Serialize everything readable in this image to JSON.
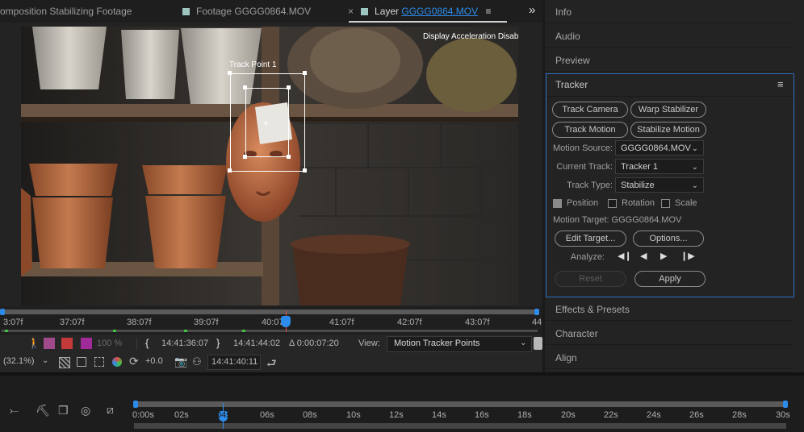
{
  "tabs": {
    "composition": "omposition Stabilizing Footage",
    "footage_prefix": "Footage",
    "footage_name": "GGGG0864.MOV",
    "layer_prefix": "Layer",
    "layer_name": "GGGG0864.MOV",
    "close_glyph": "×",
    "menu_glyph": "≡",
    "overflow_glyph": "»"
  },
  "viewer": {
    "notice": "Display Acceleration Disabled",
    "track_point_label": "Track Point 1"
  },
  "ruler": {
    "ticks": [
      "3:07f",
      "37:07f",
      "38:07f",
      "39:07f",
      "40:07",
      "41:07f",
      "42:07f",
      "43:07f",
      "44"
    ]
  },
  "controls": {
    "in_time": "14:41:36:07",
    "out_time": "14:41:44:02",
    "duration": "Δ 0:00:07:20",
    "view_label": "View:",
    "view_value": "Motion Tracker Points",
    "zoom": "(32.1%)",
    "exposure": "+0.0",
    "current_time": "14:41:40:11",
    "opacity": "100 %"
  },
  "panels": {
    "info": "Info",
    "audio": "Audio",
    "preview": "Preview",
    "effects": "Effects & Presets",
    "character": "Character",
    "align": "Align"
  },
  "tracker": {
    "title": "Tracker",
    "track_camera": "Track Camera",
    "warp_stabilizer": "Warp Stabilizer",
    "track_motion": "Track Motion",
    "stabilize_motion": "Stabilize Motion",
    "motion_source_label": "Motion Source:",
    "motion_source_value": "GGGG0864.MOV",
    "current_track_label": "Current Track:",
    "current_track_value": "Tracker 1",
    "track_type_label": "Track Type:",
    "track_type_value": "Stabilize",
    "position_label": "Position",
    "rotation_label": "Rotation",
    "scale_label": "Scale",
    "motion_target": "Motion Target:  GGGG0864.MOV",
    "edit_target": "Edit Target...",
    "options": "Options...",
    "analyze_label": "Analyze:",
    "reset": "Reset",
    "apply": "Apply"
  },
  "timeline": {
    "ticks": [
      "0:00s",
      "02s",
      "04s",
      "06s",
      "08s",
      "10s",
      "12s",
      "14s",
      "16s",
      "18s",
      "20s",
      "22s",
      "24s",
      "26s",
      "28s",
      "30s"
    ]
  },
  "colors": {
    "accent": "#2d8ceb",
    "panel_focus": "#2d6fc0",
    "tab_swatch": "#9ec6c0"
  }
}
